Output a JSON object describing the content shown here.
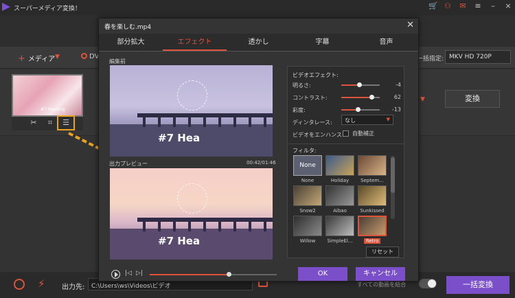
{
  "app": {
    "title": "スーパーメディア変換！"
  },
  "colors": {
    "accent": "#e0533b",
    "primary_button": "#7a4fc9",
    "panel": "#2c2c2c",
    "highlight": "#e6a320"
  },
  "toolbar": {
    "add_media_label": "メディア",
    "dvd_label": "DV",
    "batch_label": "一括指定:",
    "format_value": "MKV HD 720P"
  },
  "file": {
    "thumb_caption": "#7 Heading",
    "convert_label": "変換"
  },
  "bottom": {
    "output_label": "出力先:",
    "output_path": "C:\\Users\\ws\\Videos\\ビデオ",
    "merge_label": "すべての動画を結合",
    "convert_all_label": "一括変換"
  },
  "dialog": {
    "title": "春を楽しむ.mp4",
    "tabs": [
      "部分拡大",
      "エフェクト",
      "透かし",
      "字幕",
      "音声"
    ],
    "active_tab": "エフェクト",
    "before_label": "編集前",
    "after_label": "出力プレビュー",
    "time": "00:42/01:46",
    "preview_title": "#7 Hea",
    "playback_progress": 0.62,
    "effects": {
      "heading": "ビデオエフェクト:",
      "brightness": {
        "label": "明るさ:",
        "value": "-4",
        "level": 0.47
      },
      "contrast": {
        "label": "コントラスト:",
        "value": "62",
        "level": 0.78
      },
      "saturation": {
        "label": "彩度:",
        "value": "-13",
        "level": 0.42
      },
      "deinterlace": {
        "label": "ディンタレース:",
        "value": "なし"
      },
      "enhance": {
        "label": "ビデオをエンハンス:",
        "checkbox_label": "自動補正"
      }
    },
    "filters": {
      "heading": "フィルタ:",
      "items": [
        {
          "name": "None",
          "thumb_text": "None",
          "selected": false
        },
        {
          "name": "Holiday",
          "selected": false
        },
        {
          "name": "Septem...",
          "selected": false
        },
        {
          "name": "Snow2",
          "selected": false
        },
        {
          "name": "Aibao",
          "selected": false
        },
        {
          "name": "Sunkissed",
          "selected": false
        },
        {
          "name": "Willow",
          "selected": false
        },
        {
          "name": "SimpleEl...",
          "selected": false
        },
        {
          "name": "Retro",
          "selected": true
        }
      ],
      "reset_label": "リセット"
    },
    "ok_label": "OK",
    "cancel_label": "キャンセル"
  }
}
